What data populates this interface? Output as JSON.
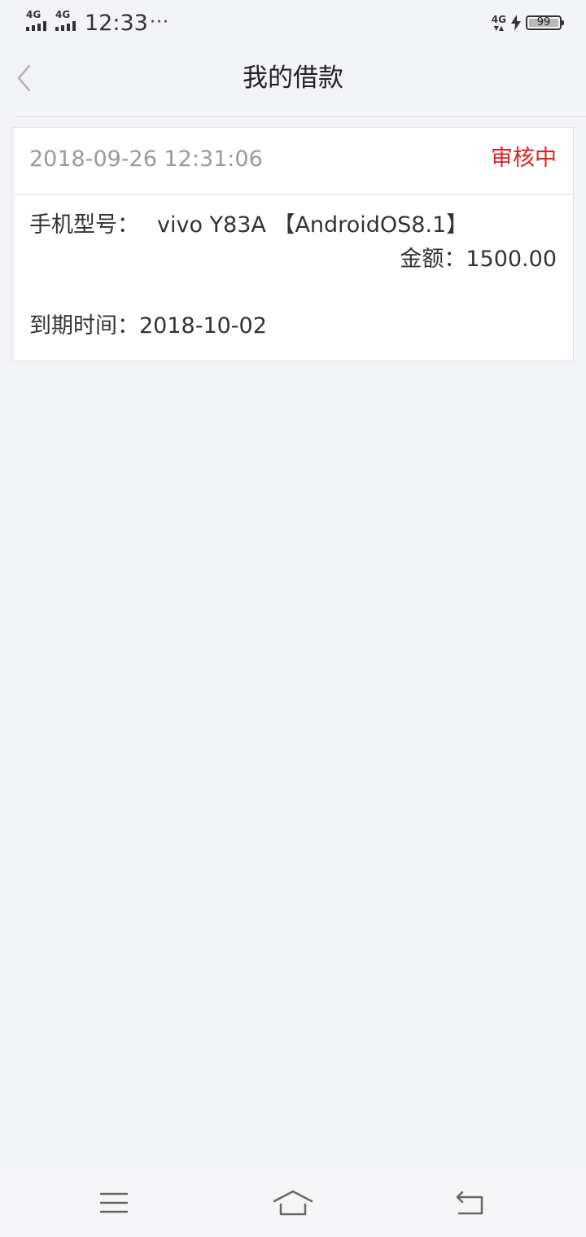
{
  "status_bar": {
    "network_1": "4G",
    "network_2": "4G",
    "time": "12:33",
    "more": "···",
    "network_right": "4G",
    "battery_level": "99",
    "battery_fraction": 0.99
  },
  "nav": {
    "title": "我的借款",
    "back_icon": "chevron-left-icon"
  },
  "loan": {
    "datetime": "2018-09-26 12:31:06",
    "status": "审核中",
    "device_label": "手机型号：",
    "device_value": "vivo Y83A 【AndroidOS8.1】",
    "amount_label": "金额：",
    "amount_value": "1500.00",
    "due_label": "到期时间：",
    "due_value": "2018-10-02"
  },
  "bottom_nav": {
    "menu_icon": "menu-icon",
    "home_icon": "home-icon",
    "back_icon": "back-arrow-icon"
  },
  "colors": {
    "background": "#f3f4f8",
    "card": "#ffffff",
    "status_pending": "#e02020",
    "muted_text": "#9a9a9a",
    "text": "#333333"
  }
}
